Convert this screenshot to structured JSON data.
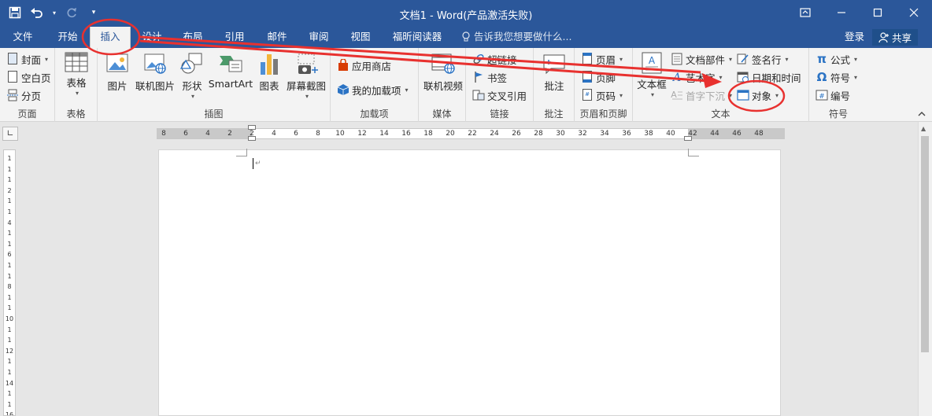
{
  "window": {
    "title": "文档1 - Word(产品激活失败)"
  },
  "tabs": [
    {
      "label": "文件"
    },
    {
      "label": "开始"
    },
    {
      "label": "插入"
    },
    {
      "label": "设计"
    },
    {
      "label": "布局"
    },
    {
      "label": "引用"
    },
    {
      "label": "邮件"
    },
    {
      "label": "审阅"
    },
    {
      "label": "视图"
    },
    {
      "label": "福昕阅读器"
    }
  ],
  "active_tab": "插入",
  "tell_me": "告诉我您想要做什么...",
  "account": {
    "login": "登录",
    "share": "共享"
  },
  "ribbon": {
    "pages": {
      "label": "页面",
      "cover": "封面",
      "blank": "空白页",
      "break": "分页"
    },
    "tables": {
      "label": "表格",
      "table": "表格"
    },
    "illustrations": {
      "label": "插图",
      "picture": "图片",
      "online_picture": "联机图片",
      "shapes": "形状",
      "smartart": "SmartArt",
      "chart": "图表",
      "screenshot": "屏幕截图"
    },
    "addins": {
      "label": "加载项",
      "store": "应用商店",
      "my_addins": "我的加载项"
    },
    "media": {
      "label": "媒体",
      "online_video": "联机视频"
    },
    "links": {
      "label": "链接",
      "hyperlink": "超链接",
      "bookmark": "书签",
      "crossref": "交叉引用"
    },
    "comments": {
      "label": "批注",
      "comment": "批注"
    },
    "header_footer": {
      "label": "页眉和页脚",
      "header": "页眉",
      "footer": "页脚",
      "page_number": "页码"
    },
    "text": {
      "label": "文本",
      "textbox": "文本框",
      "quick_parts": "文档部件",
      "wordart": "艺术字",
      "dropcap": "首字下沉",
      "signature": "签名行",
      "datetime": "日期和时间",
      "object": "对象"
    },
    "symbols": {
      "label": "符号",
      "equation": "公式",
      "symbol": "符号",
      "number": "编号"
    }
  },
  "ruler": {
    "ticks": [
      "8",
      "6",
      "4",
      "2",
      "2",
      "4",
      "6",
      "8",
      "10",
      "12",
      "14",
      "16",
      "18",
      "20",
      "22",
      "24",
      "26",
      "28",
      "30",
      "32",
      "34",
      "36",
      "38",
      "40",
      "42",
      "44",
      "46",
      "48"
    ],
    "vticks": [
      "1",
      "1",
      "1",
      "2",
      "1",
      "1",
      "4",
      "1",
      "1",
      "6",
      "1",
      "1",
      "8",
      "1",
      "1",
      "10",
      "1",
      "1",
      "12",
      "1",
      "1",
      "14",
      "1",
      "1",
      "16"
    ]
  },
  "colors": {
    "brand": "#2b579a",
    "annotation_red": "#e8312f"
  }
}
